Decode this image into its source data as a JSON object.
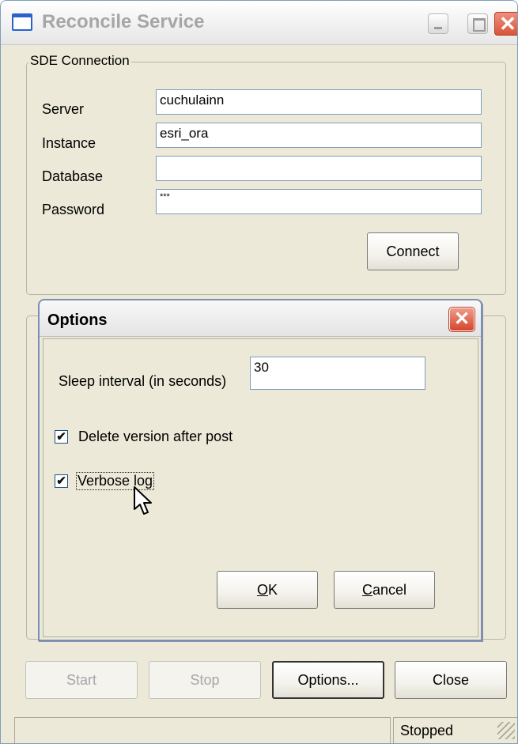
{
  "window": {
    "title": "Reconcile Service",
    "title_icon": "app-window-icon",
    "controls": {
      "minimize_icon": "minimize-icon",
      "maximize_icon": "maximize-icon",
      "close_glyph": "✕"
    }
  },
  "sde_connection": {
    "legend": "SDE Connection",
    "fields": [
      {
        "label": "Server",
        "value": "cuchulainn"
      },
      {
        "label": "Instance",
        "value": "esri_ora"
      },
      {
        "label": "Database",
        "value": ""
      },
      {
        "label": "Password",
        "value": "***"
      }
    ],
    "connect_label": "Connect"
  },
  "footer": {
    "start_label": "Start",
    "stop_label": "Stop",
    "options_label": "Options...",
    "close_label": "Close"
  },
  "status": {
    "left": "",
    "right": "Stopped"
  },
  "options_dialog": {
    "title": "Options",
    "close_glyph": "✕",
    "sleep_label": "Sleep interval (in seconds)",
    "sleep_value": "30",
    "delete_version": {
      "label": "Delete version after post",
      "checked": true
    },
    "verbose_log": {
      "label": "Verbose log",
      "checked": true
    },
    "ok_label": "OK",
    "cancel_label": "Cancel"
  },
  "colors": {
    "window_face": "#ece9d8",
    "textbox_border": "#7f9db9",
    "close_red": "#d9553b",
    "disabled_text": "#a7a6aa"
  }
}
